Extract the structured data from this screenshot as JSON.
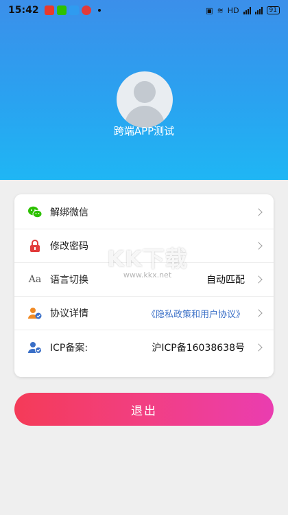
{
  "status_bar": {
    "time": "15:42",
    "network_label": "HD",
    "battery": "91"
  },
  "profile": {
    "username": "跨端APP测试"
  },
  "settings": {
    "rows": [
      {
        "label": "解绑微信",
        "value": "",
        "icon": "wechat-icon"
      },
      {
        "label": "修改密码",
        "value": "",
        "icon": "lock-icon"
      },
      {
        "label": "语言切换",
        "value": "自动匹配",
        "icon": "language-icon",
        "icon_text": "Aa"
      },
      {
        "label": "协议详情",
        "value": "《隐私政策和用户协议》",
        "icon": "user-agreement-icon"
      },
      {
        "label": "ICP备案:",
        "value": "沪ICP备16038638号",
        "icon": "user-check-icon"
      }
    ]
  },
  "logout": {
    "label": "退出"
  },
  "watermark": {
    "big": "KK下载",
    "small": "www.kkx.net"
  },
  "colors": {
    "header_top": "#3b8fea",
    "header_bottom": "#1fb6f4",
    "logout_start": "#f43b58",
    "logout_end": "#ea3db0",
    "wechat": "#2dc100",
    "lock": "#e23b3b",
    "link": "#3a6fc7"
  }
}
